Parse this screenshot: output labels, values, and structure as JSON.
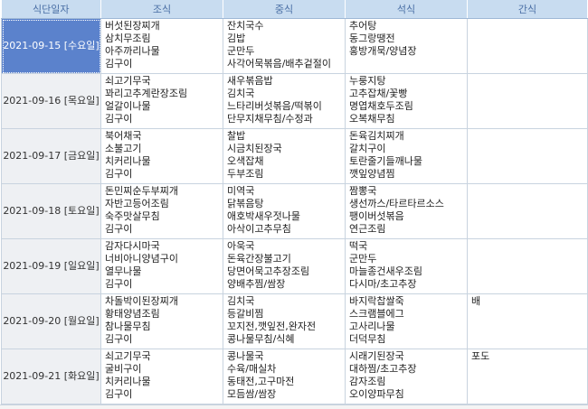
{
  "headers": {
    "date": "식단일자",
    "breakfast": "조식",
    "lunch": "중식",
    "dinner": "석식",
    "snack": "간식"
  },
  "rows": [
    {
      "date": "2021-09-15 [수요일]",
      "breakfast": [
        "버섯된장찌개",
        "삼치무조림",
        "아주까리나물",
        "김구이"
      ],
      "lunch": [
        "잔치국수",
        "김밥",
        "군만두",
        "사각어묵볶음/배추겉절이"
      ],
      "dinner": [
        "추어탕",
        "동그랑땡전",
        "홍방개묵/양념장"
      ],
      "snack": [
        ""
      ]
    },
    {
      "date": "2021-09-16 [목요일]",
      "breakfast": [
        "쇠고기무국",
        "꽈리고추계란장조림",
        "얼갈이나물",
        "김구이"
      ],
      "lunch": [
        "새우볶음밥",
        "김치국",
        "느타리버섯볶음/떡볶이",
        "단무지채무침/수정과"
      ],
      "dinner": [
        "누룽지탕",
        "고추잡채/꽃빵",
        "명엽채호두조림",
        "오복채무침"
      ],
      "snack": [
        ""
      ]
    },
    {
      "date": "2021-09-17 [금요일]",
      "breakfast": [
        "북어채국",
        "소불고기",
        "치커리나물",
        "김구이"
      ],
      "lunch": [
        "찰밥",
        "시금치된장국",
        "오색잡채",
        "두부조림"
      ],
      "dinner": [
        "돈육김치찌개",
        "갈치구이",
        "토란줄기들깨나물",
        "깻잎양념찜"
      ],
      "snack": [
        ""
      ]
    },
    {
      "date": "2021-09-18 [토요일]",
      "breakfast": [
        "돈민찌순두부찌개",
        "자반고등어조림",
        "숙주맛살무침",
        "김구이"
      ],
      "lunch": [
        "미역국",
        "닭볶음탕",
        "애호박새우젓나물",
        "아삭이고추무침"
      ],
      "dinner": [
        "짬뽕국",
        "생선까스/타르타르소스",
        "팽이버섯볶음",
        "연근조림"
      ],
      "snack": [
        ""
      ]
    },
    {
      "date": "2021-09-19 [일요일]",
      "breakfast": [
        "감자다시마국",
        "너비아니양념구이",
        "열무나물",
        "김구이"
      ],
      "lunch": [
        "아욱국",
        "돈육간장불고기",
        "당면어묵고추장조림",
        "양배추찜/쌈장"
      ],
      "dinner": [
        "떡국",
        "군만두",
        "마늘종건새우조림",
        "다시마/초고추장"
      ],
      "snack": [
        ""
      ]
    },
    {
      "date": "2021-09-20 [월요일]",
      "breakfast": [
        "차돌박이된장찌개",
        "황태양념조림",
        "참나물무침",
        "김구이"
      ],
      "lunch": [
        "김치국",
        "등갈비찜",
        "꼬지전,깻잎전,완자전",
        "콩나물무침/식혜"
      ],
      "dinner": [
        "바지락찹쌀죽",
        "스크램블에그",
        "고사리나물",
        "더덕무침"
      ],
      "snack": [
        "배"
      ]
    },
    {
      "date": "2021-09-21 [화요일]",
      "breakfast": [
        "쇠고기무국",
        "굴비구이",
        "치커리나물",
        "김구이"
      ],
      "lunch": [
        "콩나물국",
        "수육/매실차",
        "동태전,고구마전",
        "모듬쌈/쌈장"
      ],
      "dinner": [
        "시래기된장국",
        "대하찜/초고추장",
        "감자조림",
        "오이양파무침"
      ],
      "snack": [
        "포도"
      ]
    }
  ]
}
